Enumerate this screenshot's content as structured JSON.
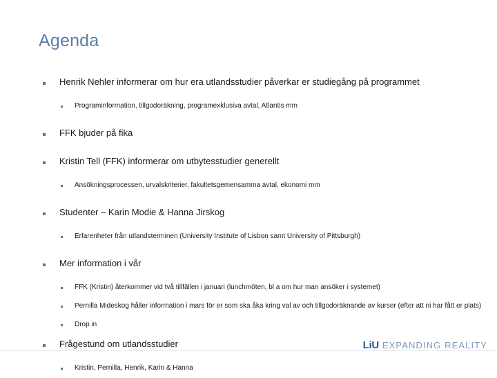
{
  "slide": {
    "title": "Agenda",
    "items": [
      {
        "text": "Henrik Nehler informerar om hur era utlandsstudier påverkar er studiegång på programmet",
        "sub": [
          "Programinformation, tillgodoräkning, programexklusiva avtal, Atlantis mm"
        ]
      },
      {
        "text": "FFK bjuder på fika",
        "sub": []
      },
      {
        "text": "Kristin Tell (FFK) informerar om utbytesstudier generellt",
        "sub": [
          "Ansökningsprocessen, urvalskriterier, fakultetsgemensamma avtal, ekonomi mm"
        ]
      },
      {
        "text": "Studenter – Karin Modie & Hanna Jirskog",
        "sub": [
          "Erfarenheter från utlandsterminen (University Institute of Lisbon samt University of Pittsburgh)"
        ]
      },
      {
        "text": "Mer information i vår",
        "sub": [
          "FFK (Kristin) återkommer vid två tillfällen i januari (lunchmöten, bl a om hur man ansöker i systemet)",
          "Pernilla Mideskog håller information i mars för er som ska åka kring val av och tillgodoräknande av kurser (efter att ni har fått er plats)",
          "Drop in"
        ]
      },
      {
        "text": "Frågestund om utlandsstudier",
        "sub": [
          "Kristin, Pernilla, Henrik, Karin & Hanna"
        ]
      }
    ]
  },
  "footer": {
    "logo_mark": "LiU",
    "logo_tagline": "EXPANDING REALITY"
  },
  "colors": {
    "title": "#5B7FA6",
    "bullet": "#5E7389",
    "body_text": "#1a1a1a",
    "logo_mark": "#2D5B8E",
    "logo_tagline": "#7E9BBC",
    "rule": "#e3e9ef"
  }
}
